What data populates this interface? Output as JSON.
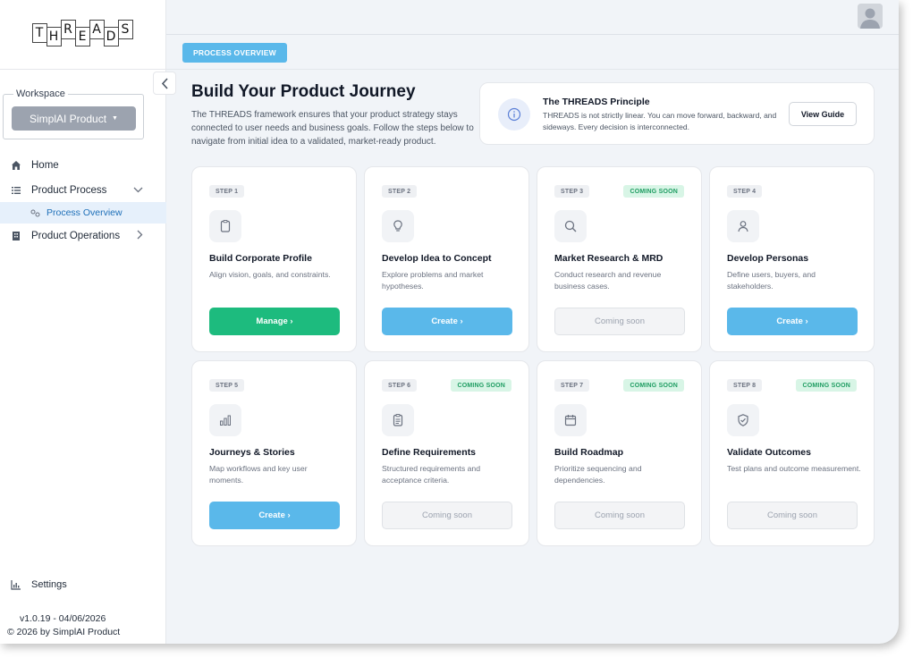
{
  "app": {
    "logo_letters": [
      "T",
      "H",
      "R",
      "E",
      "A",
      "D",
      "S"
    ]
  },
  "sidebar": {
    "workspace_label": "Workspace",
    "workspace_value": "SimplAI Product",
    "nav": [
      {
        "label": "Home",
        "icon": "home-icon"
      },
      {
        "label": "Product Process",
        "icon": "list-icon",
        "expanded": true
      },
      {
        "label": "Process Overview",
        "icon": "flow-icon",
        "active": true
      },
      {
        "label": "Product Operations",
        "icon": "building-icon"
      }
    ],
    "settings_label": "Settings",
    "version": "v1.0.19 - 04/06/2026",
    "copyright": "© 2026 by SimplAI Product"
  },
  "header": {
    "breadcrumb": "PROCESS OVERVIEW"
  },
  "main": {
    "title": "Build Your Product Journey",
    "description": "The THREADS framework ensures that your product strategy stays connected to user needs and business goals. Follow the steps below to navigate from initial idea to a validated, market-ready product.",
    "principle": {
      "title": "The THREADS Principle",
      "text": "THREADS is not strictly linear. You can move forward, backward, and sideways. Every decision is interconnected.",
      "button": "View Guide"
    },
    "steps": [
      {
        "step": "STEP 1",
        "badge": "",
        "icon": "clipboard-icon",
        "title": "Build Corporate Profile",
        "desc": "Align vision, goals, and constraints.",
        "button": "Manage ›",
        "button_style": "green"
      },
      {
        "step": "STEP 2",
        "badge": "",
        "icon": "lightbulb-icon",
        "title": "Develop Idea to Concept",
        "desc": "Explore problems and market hypotheses.",
        "button": "Create ›",
        "button_style": "blue"
      },
      {
        "step": "STEP 3",
        "badge": "COMING SOON",
        "icon": "search-icon",
        "title": "Market Research & MRD",
        "desc": "Conduct research and revenue business cases.",
        "button": "Coming soon",
        "button_style": "soon"
      },
      {
        "step": "STEP 4",
        "badge": "",
        "icon": "user-icon",
        "title": "Develop Personas",
        "desc": "Define users, buyers, and stakeholders.",
        "button": "Create ›",
        "button_style": "blue"
      },
      {
        "step": "STEP 5",
        "badge": "",
        "icon": "bar-chart-icon",
        "title": "Journeys & Stories",
        "desc": "Map workflows and key user moments.",
        "button": "Create ›",
        "button_style": "blue"
      },
      {
        "step": "STEP 6",
        "badge": "COMING SOON",
        "icon": "clipboard-list-icon",
        "title": "Define Requirements",
        "desc": "Structured requirements and acceptance criteria.",
        "button": "Coming soon",
        "button_style": "soon"
      },
      {
        "step": "STEP 7",
        "badge": "COMING SOON",
        "icon": "calendar-icon",
        "title": "Build Roadmap",
        "desc": "Prioritize sequencing and dependencies.",
        "button": "Coming soon",
        "button_style": "soon"
      },
      {
        "step": "STEP 8",
        "badge": "COMING SOON",
        "icon": "shield-check-icon",
        "title": "Validate Outcomes",
        "desc": "Test plans and outcome measurement.",
        "button": "Coming soon",
        "button_style": "soon"
      }
    ]
  },
  "colors": {
    "accent_blue": "#5ab8ea",
    "accent_green": "#1dbb7e",
    "badge_green": "#1f9d62",
    "active_nav": "#1d6fb8"
  }
}
